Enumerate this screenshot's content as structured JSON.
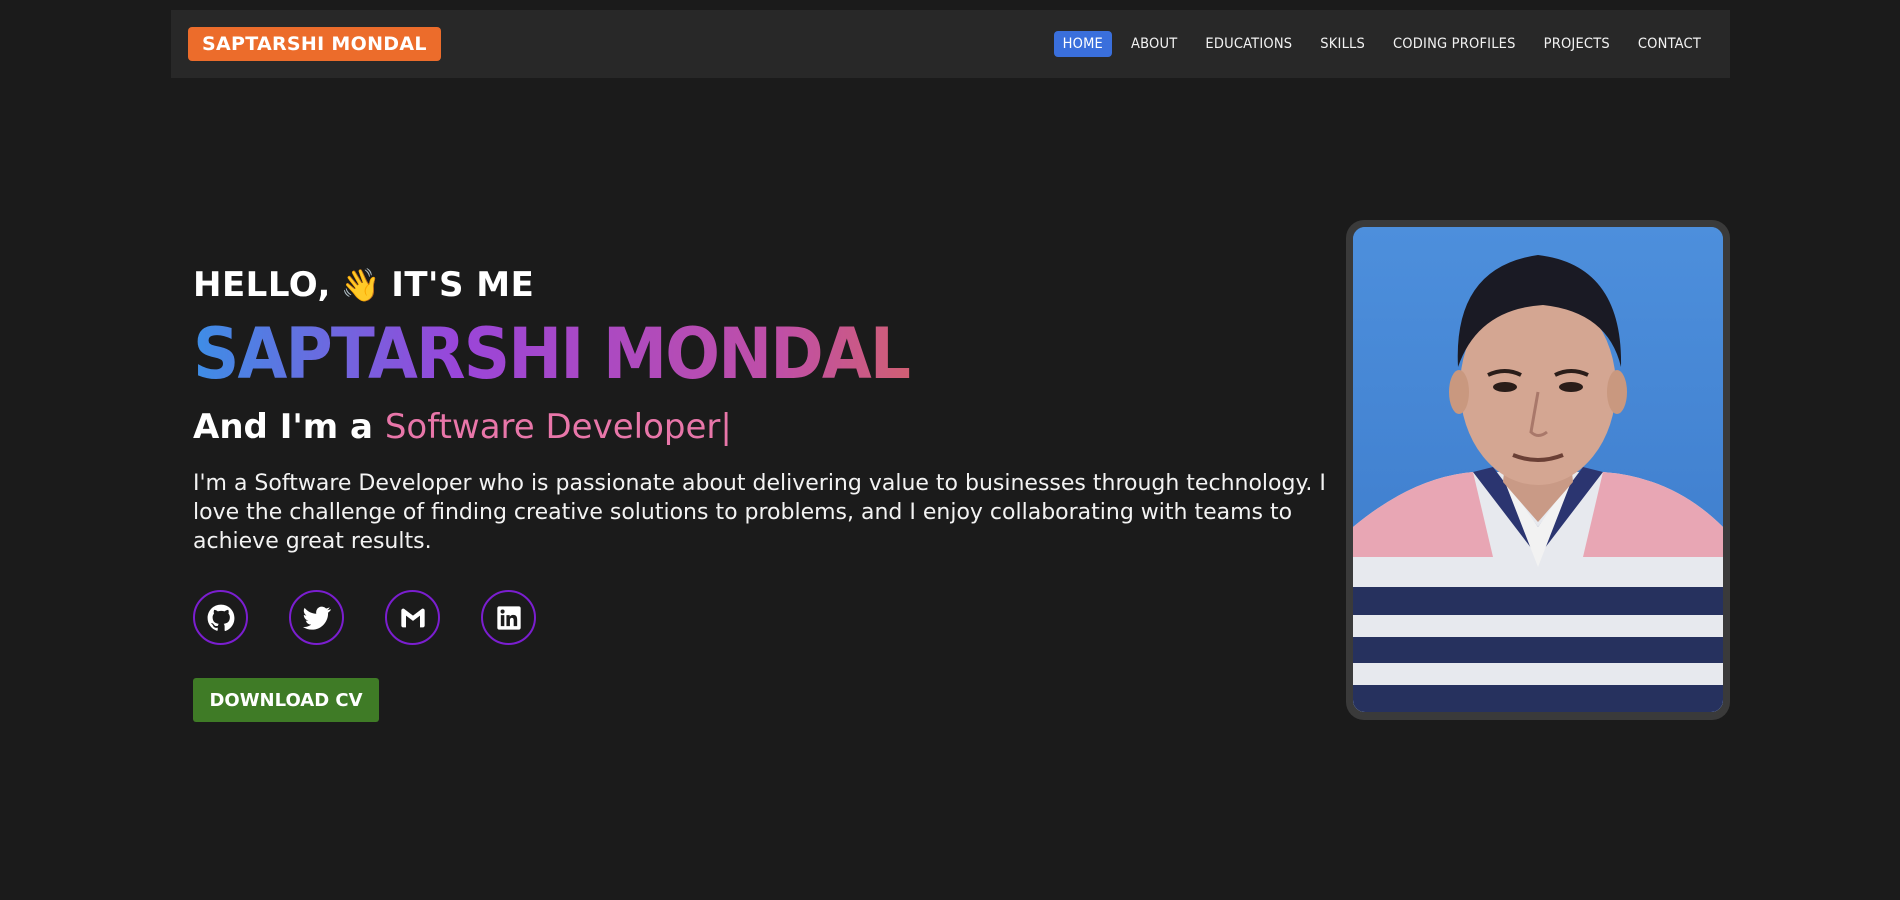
{
  "brand": {
    "label": "SAPTARSHI MONDAL"
  },
  "nav": {
    "items": [
      {
        "label": "HOME",
        "active": true
      },
      {
        "label": "ABOUT",
        "active": false
      },
      {
        "label": "EDUCATIONS",
        "active": false
      },
      {
        "label": "SKILLS",
        "active": false
      },
      {
        "label": "CODING PROFILES",
        "active": false
      },
      {
        "label": "PROJECTS",
        "active": false
      },
      {
        "label": "CONTACT",
        "active": false
      }
    ]
  },
  "hero": {
    "greeting_part1": "HELLO,",
    "wave_emoji": "👋",
    "greeting_part2": "IT'S ME",
    "name": "SAPTARSHI MONDAL",
    "role_prefix": "And I'm a",
    "role": "Software Developer",
    "cursor": "|",
    "bio": "I'm a Software Developer who is passionate about delivering value to businesses through technology. I love the challenge of finding creative solutions to problems, and I enjoy collaborating with teams to achieve great results.",
    "socials": [
      {
        "icon": "github-icon"
      },
      {
        "icon": "twitter-icon"
      },
      {
        "icon": "gmail-icon"
      },
      {
        "icon": "linkedin-icon"
      }
    ],
    "cv_button": "DOWNLOAD CV"
  },
  "colors": {
    "background": "#1b1b1b",
    "navbar": "#282828",
    "brand": "#ec6c2b",
    "nav_active": "#3a6fdc",
    "role_highlight": "#e876a9",
    "social_border": "#7b1ed0",
    "cv_button": "#3f7b26"
  }
}
